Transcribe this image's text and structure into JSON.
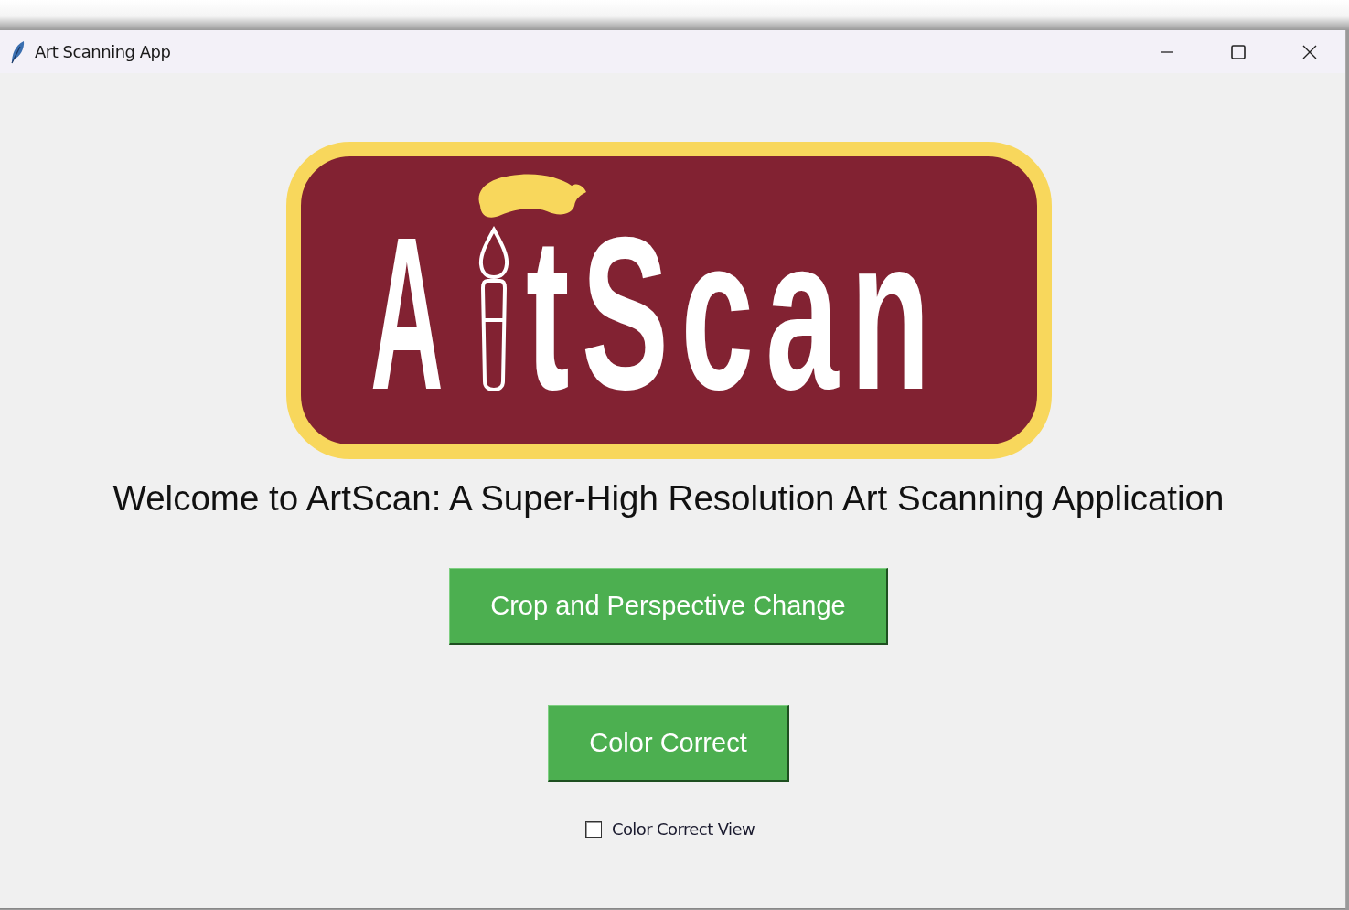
{
  "window": {
    "title": "Art Scanning App"
  },
  "logo": {
    "lead": "A",
    "tail": "tScan"
  },
  "welcome": "Welcome to ArtScan: A Super-High Resolution Art Scanning Application",
  "buttons": [
    {
      "label": "Crop and Perspective Change"
    },
    {
      "label": "Color Correct"
    }
  ],
  "checkbox": {
    "label": "Color Correct View",
    "checked": false
  }
}
